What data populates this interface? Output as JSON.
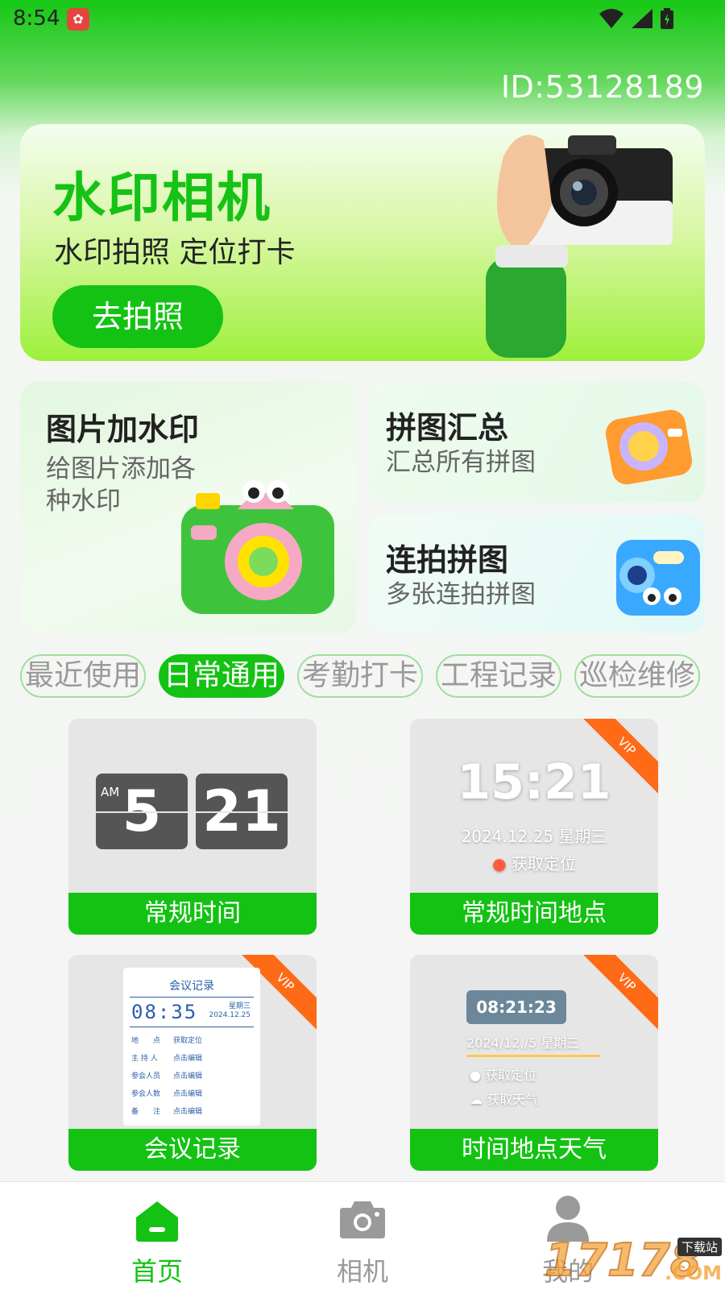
{
  "status": {
    "time": "8:54",
    "app_badge": "✿"
  },
  "user": {
    "id_text": "ID:53128189"
  },
  "hero": {
    "title": "水印相机",
    "subtitle": "水印拍照 定位打卡",
    "button": "去拍照"
  },
  "features": [
    {
      "title": "图片加水印",
      "desc": "给图片添加各\n种水印"
    },
    {
      "title": "拼图汇总",
      "desc": "汇总所有拼图"
    },
    {
      "title": "连拍拼图",
      "desc": "多张连拍拼图"
    }
  ],
  "tabs": [
    {
      "label": "最近使用",
      "active": false
    },
    {
      "label": "日常通用",
      "active": true
    },
    {
      "label": "考勤打卡",
      "active": false
    },
    {
      "label": "工程记录",
      "active": false
    },
    {
      "label": "巡检维修",
      "active": false
    }
  ],
  "templates": [
    {
      "label": "常规时间",
      "vip": false,
      "ampm": "AM",
      "hour": "5",
      "minute": "21"
    },
    {
      "label": "常规时间地点",
      "vip": true,
      "vip_text": "VIP",
      "time": "15:21",
      "date": "2024.12.25  星期三",
      "location": "获取定位"
    },
    {
      "label": "会议记录",
      "vip": true,
      "vip_text": "VIP",
      "doc_title": "会议记录",
      "time": "08:35",
      "weekday": "星期三",
      "date": "2024.12.25",
      "rows": [
        {
          "k": "地　　点",
          "v": "获取定位"
        },
        {
          "k": "主 持 人",
          "v": "点击编辑"
        },
        {
          "k": "参会人员",
          "v": "点击编辑"
        },
        {
          "k": "参会人数",
          "v": "点击编辑"
        },
        {
          "k": "备　　注",
          "v": "点击编辑"
        }
      ]
    },
    {
      "label": "时间地点天气",
      "vip": true,
      "vip_text": "VIP",
      "time": "08:21:23",
      "date": "2024/12./5 星期三",
      "location": "获取定位",
      "weather": "获取天气"
    }
  ],
  "nav": [
    {
      "label": "首页",
      "icon": "home-icon",
      "active": true
    },
    {
      "label": "相机",
      "icon": "camera-icon",
      "active": false
    },
    {
      "label": "我的",
      "icon": "user-icon",
      "active": false
    }
  ],
  "watermark": {
    "text": "17178",
    "sub": "下载站",
    "suffix": ".COM"
  },
  "colors": {
    "primary": "#14c214",
    "vip": "#ff6a16",
    "inactive": "#9a9a9a"
  }
}
